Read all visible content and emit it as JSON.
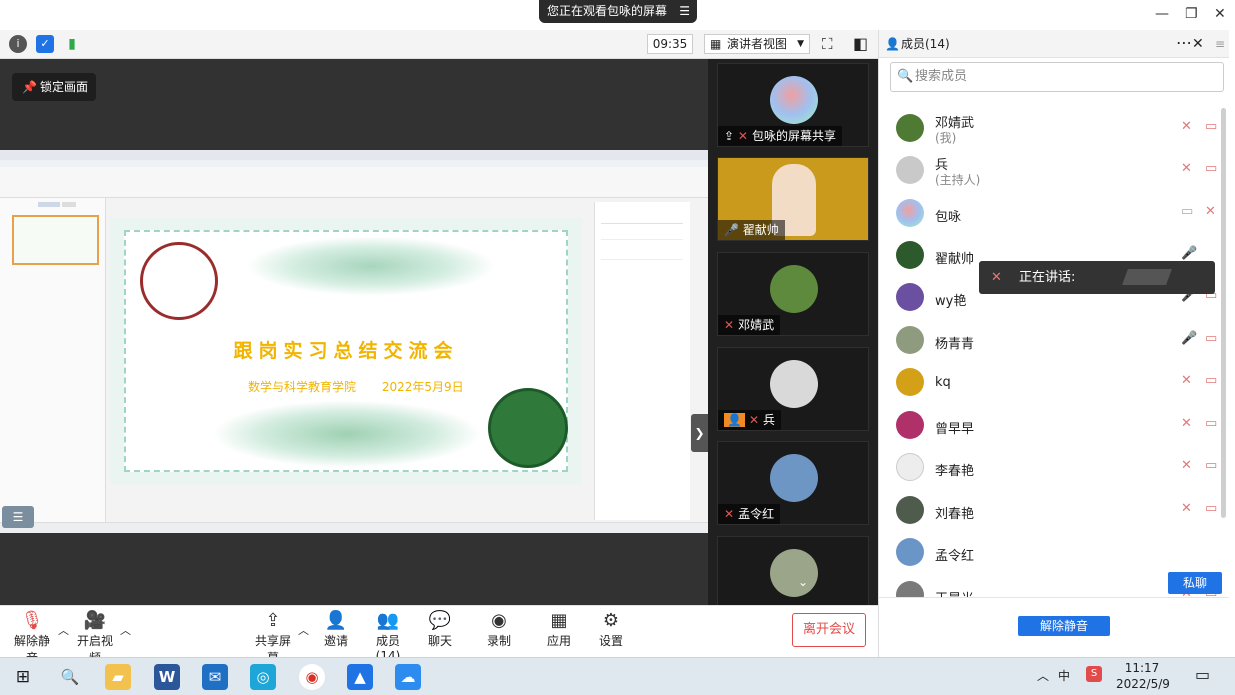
{
  "banner": {
    "text": "您正在观看包咏的屏幕",
    "menu_icon": "menu-icon"
  },
  "toolbar": {
    "time": "09:35",
    "presenter_view": "演讲者视图",
    "lock_screen": "锁定画面"
  },
  "slide": {
    "title": "跟岗实习总结交流会",
    "subtitle_school": "数学与科学教育学院",
    "subtitle_date": "2022年5月9日"
  },
  "videos": [
    {
      "name": "包咏的屏幕共享",
      "avatar_color": "#e9e9e9"
    },
    {
      "name": "翟献帅",
      "avatar_color": "#e7b320"
    },
    {
      "name": "邓婧武",
      "avatar_color": "#5e8a3d"
    },
    {
      "name": "兵",
      "avatar_color": "#d9d9d9"
    },
    {
      "name": "孟令红",
      "avatar_color": "#6d96c4"
    },
    {
      "name": "",
      "avatar_color": "#9aa58a"
    }
  ],
  "panel": {
    "title": "成员(14)",
    "search_placeholder": "搜索成员",
    "members": [
      {
        "name": "邓婧武",
        "sub": "(我)",
        "avatar_color": "#4f7a34"
      },
      {
        "name": "兵",
        "sub": "(主持人)",
        "avatar_color": "#c9c9c9"
      },
      {
        "name": "包咏",
        "sub": "",
        "avatar_color": "#e8e8e8"
      },
      {
        "name": "翟献帅",
        "sub": "",
        "avatar_color": "#2d5a2d"
      },
      {
        "name": "wy艳",
        "sub": "",
        "avatar_color": "#6b4fa0"
      },
      {
        "name": "杨青青",
        "sub": "",
        "avatar_color": "#8e9b7e"
      },
      {
        "name": "kq",
        "sub": "",
        "avatar_color": "#d4a017"
      },
      {
        "name": "曾早早",
        "sub": "",
        "avatar_color": "#b0306a"
      },
      {
        "name": "李春艳",
        "sub": "",
        "avatar_color": "#ededed"
      },
      {
        "name": "刘春艳",
        "sub": "",
        "avatar_color": "#4f5b4d"
      },
      {
        "name": "孟令红",
        "sub": "",
        "avatar_color": "#6a95c7"
      },
      {
        "name": "王晨光",
        "sub": "",
        "avatar_color": "#7a7a7a"
      }
    ],
    "chat_button": "私聊",
    "unmute_all": "解除静音",
    "speaking": "正在讲话:"
  },
  "bottom": {
    "mute": "解除静音",
    "video": "开启视频",
    "share": "共享屏幕",
    "invite": "邀请",
    "members": "成员(14)",
    "chat": "聊天",
    "record": "录制",
    "apps": "应用",
    "settings": "设置",
    "leave": "离开会议"
  },
  "taskbar": {
    "time": "11:17",
    "date": "2022/5/9",
    "ime": "中"
  },
  "colors": {
    "accent": "#1f73e5",
    "danger": "#e24b4b",
    "slide_title": "#f1b400"
  }
}
